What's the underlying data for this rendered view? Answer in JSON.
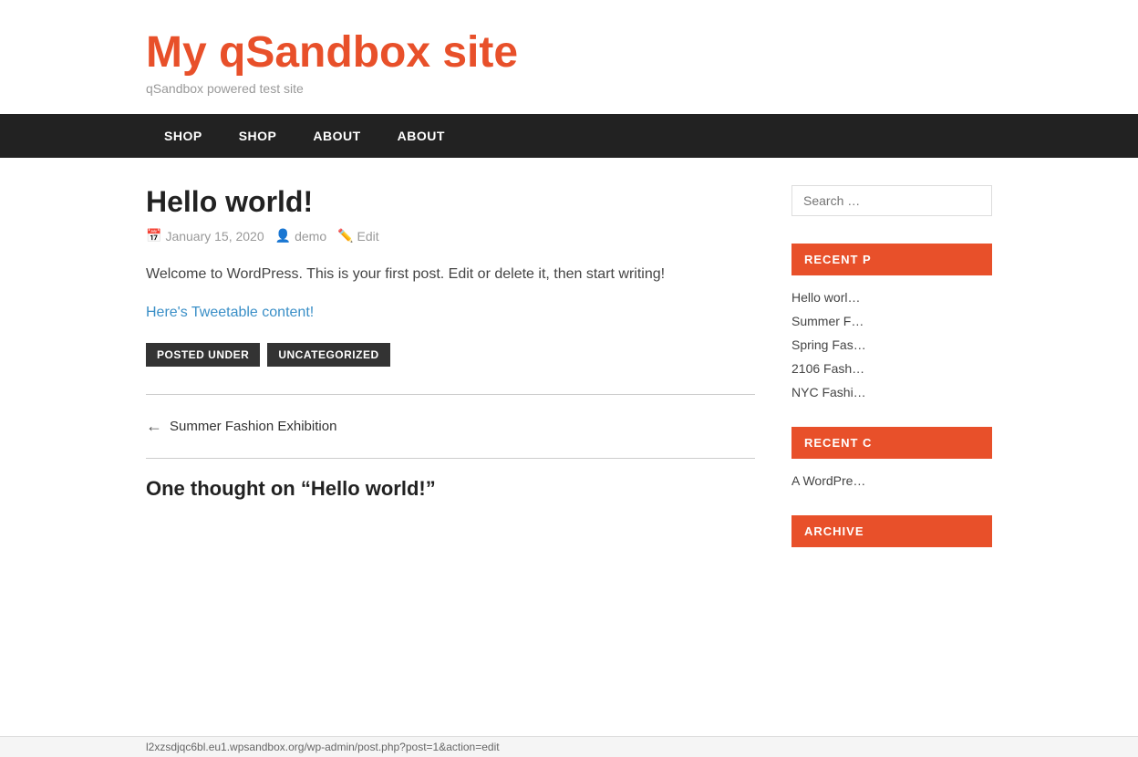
{
  "site": {
    "title": "My qSandbox site",
    "tagline": "qSandbox powered test site"
  },
  "nav": {
    "items": [
      {
        "label": "SHOP",
        "href": "#"
      },
      {
        "label": "SHOP",
        "href": "#"
      },
      {
        "label": "ABOUT",
        "href": "#"
      },
      {
        "label": "ABOUT",
        "href": "#"
      }
    ]
  },
  "post": {
    "title": "Hello world!",
    "date": "January 15, 2020",
    "author": "demo",
    "edit_label": "Edit",
    "content": "Welcome to WordPress. This is your first post. Edit or delete it, then start writing!",
    "tweetable_text": "Here's Tweetable content!",
    "tag_label": "POSTED UNDER",
    "tag_value": "UNCATEGORIZED"
  },
  "post_nav": {
    "prev_label": "Summer Fashion Exhibition"
  },
  "comments": {
    "title": "One thought on “Hello world!”"
  },
  "sidebar": {
    "search_placeholder": "Search …",
    "recent_posts_title": "RECENT P",
    "recent_posts": [
      "Hello worl…",
      "Summer F…",
      "Spring Fas…",
      "2106 Fash…",
      "NYC Fashi…"
    ],
    "recent_comments_title": "RECENT C",
    "recent_comments": [
      "A WordPre…"
    ],
    "archives_title": "ARCHIVE"
  },
  "status_bar": {
    "url": "l2xzsdjqc6bl.eu1.wpsandbox.org/wp-admin/post.php?post=1&action=edit"
  },
  "colors": {
    "accent": "#e8502a",
    "nav_bg": "#222222"
  }
}
